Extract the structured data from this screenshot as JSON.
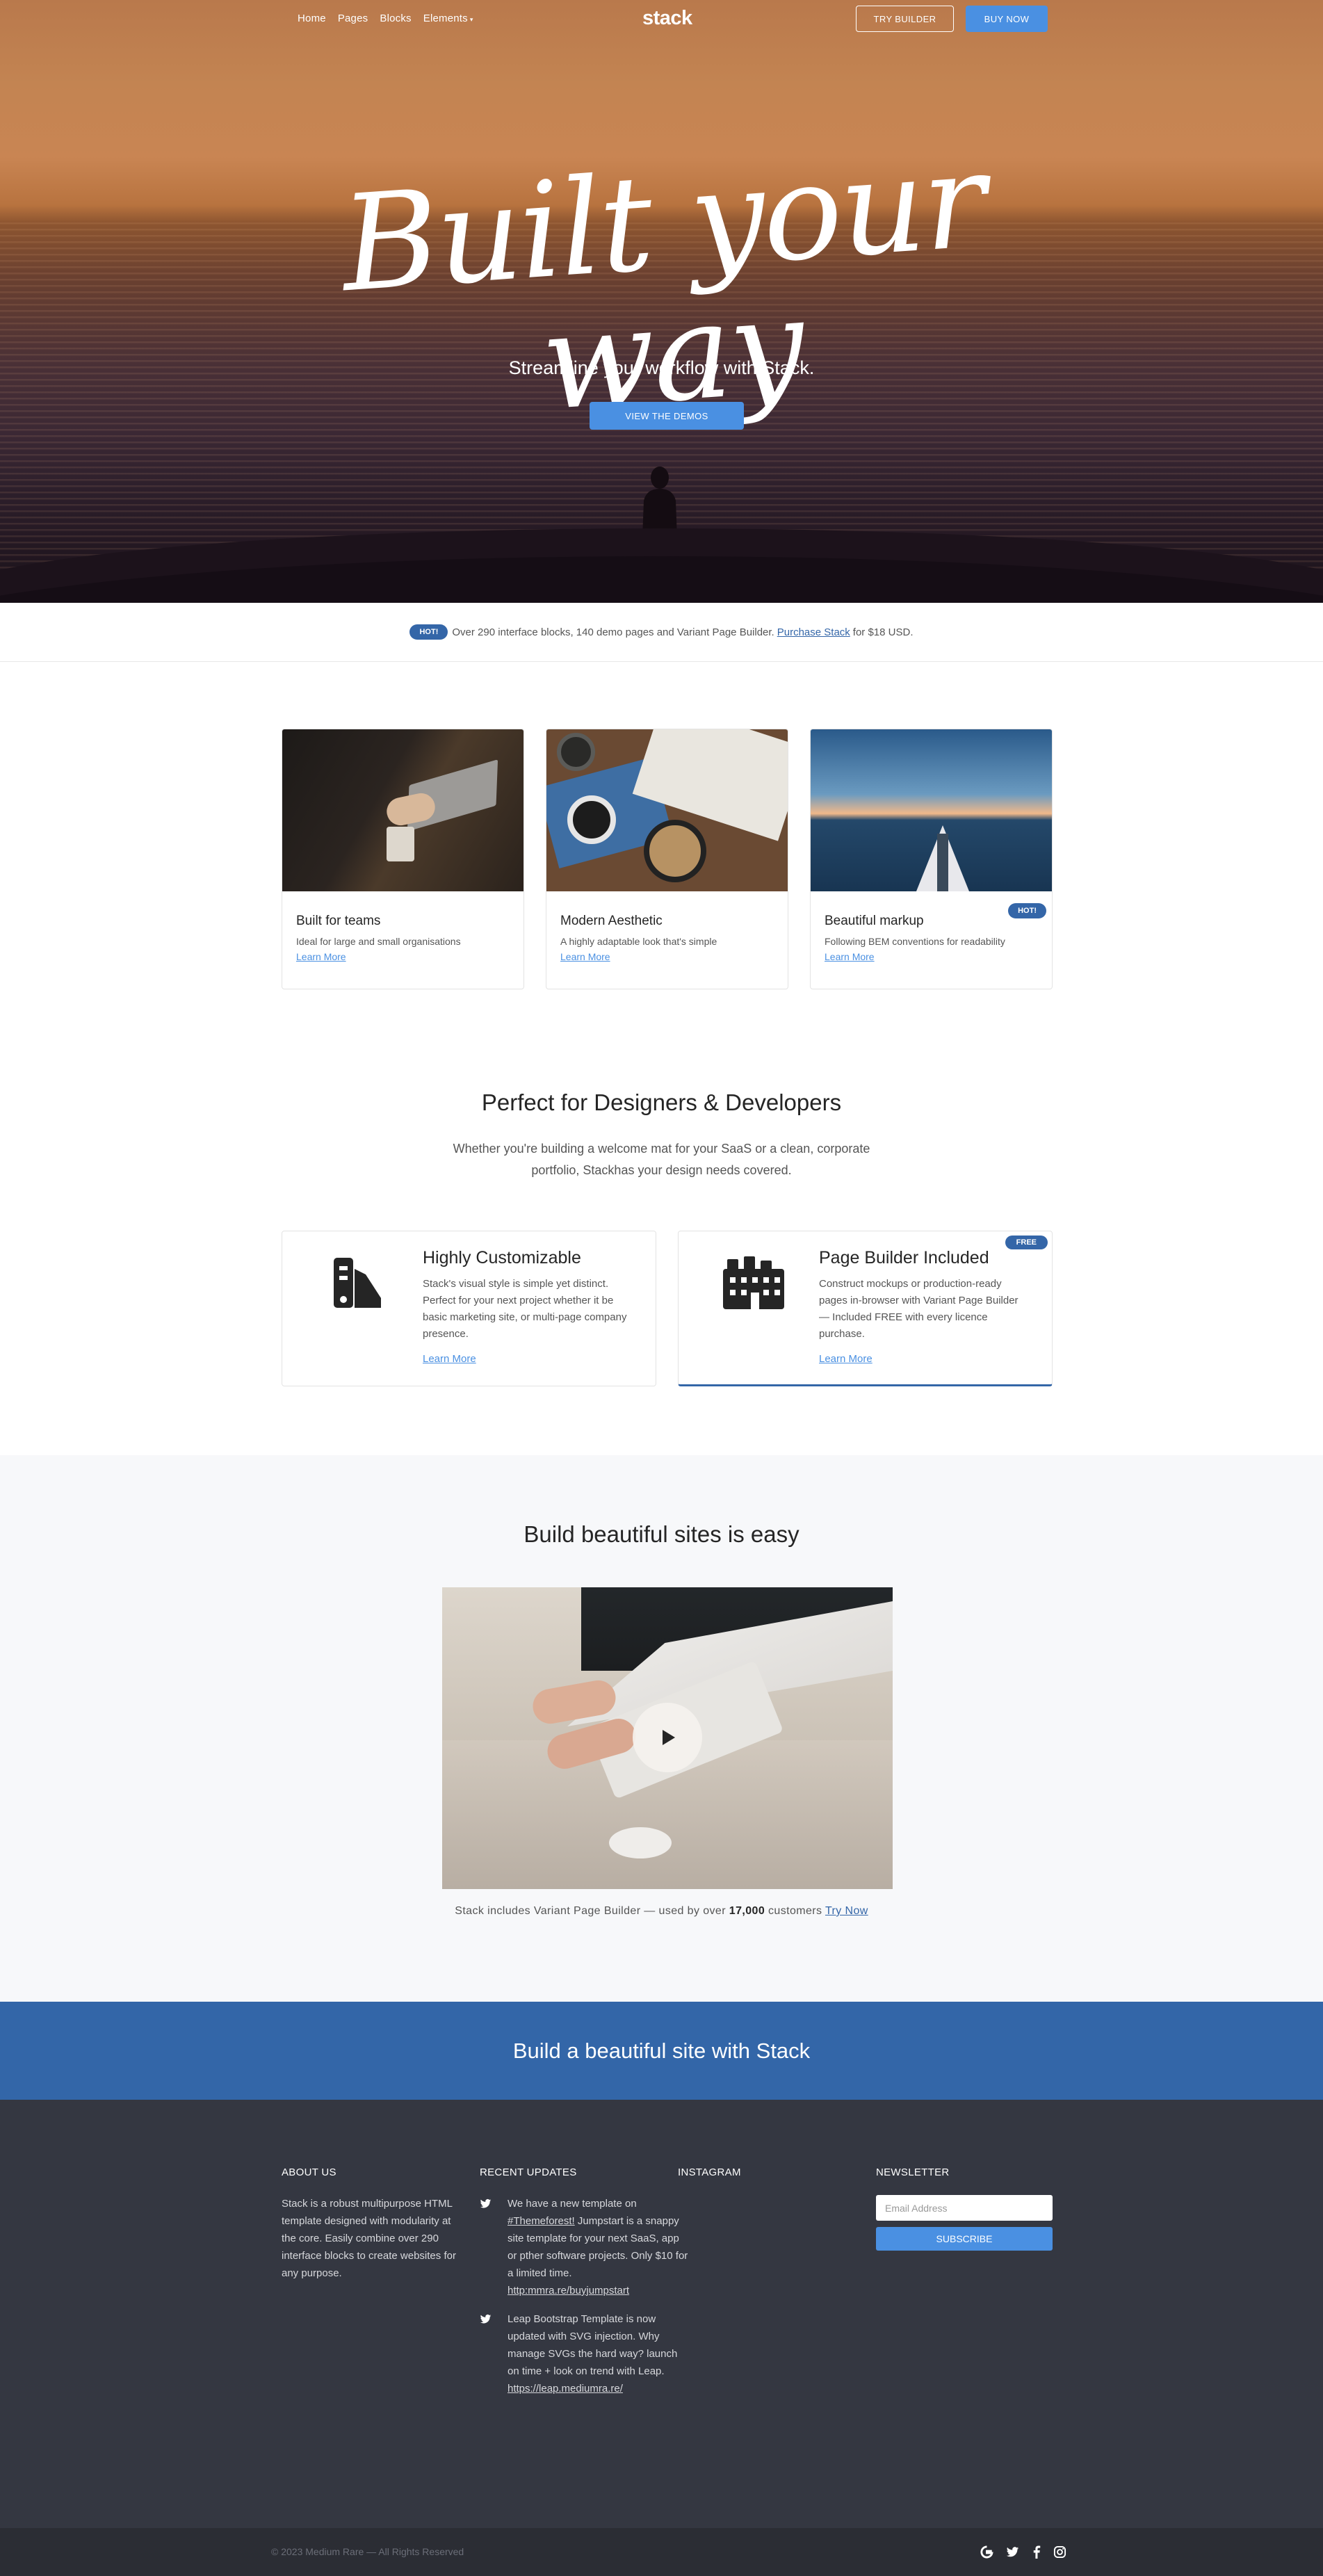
{
  "nav": {
    "links": [
      "Home",
      "Pages",
      "Blocks",
      "Elements"
    ],
    "logo": "stack",
    "try_builder": "TRY BUILDER",
    "buy_now": "BUY NOW"
  },
  "hero": {
    "title": "Built your way",
    "subtitle": "Streamline your workflow with Stack.",
    "cta": "VIEW THE DEMOS"
  },
  "notice": {
    "badge": "HOT!",
    "text_before": "Over 290 interface blocks, 140 demo pages and Variant Page Builder.",
    "link": "Purchase Stack",
    "text_after": "for $18 USD."
  },
  "cards": [
    {
      "title": "Built for teams",
      "text": "Ideal for large and small organisations",
      "link": "Learn More",
      "badge": ""
    },
    {
      "title": "Modern Aesthetic",
      "text": "A highly adaptable look that's simple",
      "link": "Learn More",
      "badge": ""
    },
    {
      "title": "Beautiful markup",
      "text": "Following BEM conventions for readability",
      "link": "Learn More",
      "badge": "HOT!"
    }
  ],
  "designers": {
    "title": "Perfect for Designers & Developers",
    "line1": "Whether you're building a welcome mat for your SaaS or a clean, corporate",
    "line2": "portfolio, Stackhas your design needs covered."
  },
  "features": [
    {
      "title": "Highly Customizable",
      "text": "Stack's visual style is simple yet distinct. Perfect for your next project whether it be basic marketing site, or multi-page company presence.",
      "link": "Learn More",
      "badge": "",
      "icon": "swatches-icon"
    },
    {
      "title": "Page Builder Included",
      "text": "Construct mockups or production-ready pages in-browser with Variant Page Builder — Included FREE with every licence purchase.",
      "link": "Learn More",
      "badge": "FREE",
      "icon": "buildings-icon"
    }
  ],
  "video_section": {
    "title": "Build beautiful sites is easy",
    "caption_before": "Stack includes Variant Page Builder — used by over",
    "caption_count": "17,000",
    "caption_mid": "customers",
    "caption_link": "Try Now"
  },
  "cta_band": {
    "text": "Build a beautiful site with Stack"
  },
  "footer": {
    "about_title": "ABOUT US",
    "about_text": "Stack is a robust multipurpose HTML template designed with modularity at the core. Easily combine over 290 interface blocks to create websites for any purpose.",
    "updates_title": "RECENT UPDATES",
    "tweets": [
      {
        "pre": "We have a new template on",
        "tag": "#Themeforest!",
        "body": "Jumpstart is a snappy site template for your next SaaS, app or pther software projects. Only $10 for a limited time.",
        "url": "http:mmra.re/buyjumpstart"
      },
      {
        "pre": "",
        "tag": "",
        "body": "Leap Bootstrap Template is now updated with SVG injection. Why manage SVGs the hard way? launch on time + look on trend with Leap.",
        "url": "https://leap.mediumra.re/"
      }
    ],
    "instagram_title": "INSTAGRAM",
    "newsletter_title": "NEWSLETTER",
    "email_placeholder": "Email Address",
    "subscribe": "SUBSCRIBE",
    "copyright": "© 2023 Medium Rare — All Rights Reserved",
    "social": [
      "google-icon",
      "twitter-icon",
      "facebook-icon",
      "instagram-icon"
    ]
  },
  "colors": {
    "accent": "#4a90e2",
    "brand_dark": "#3466a8",
    "footer": "#343741"
  }
}
